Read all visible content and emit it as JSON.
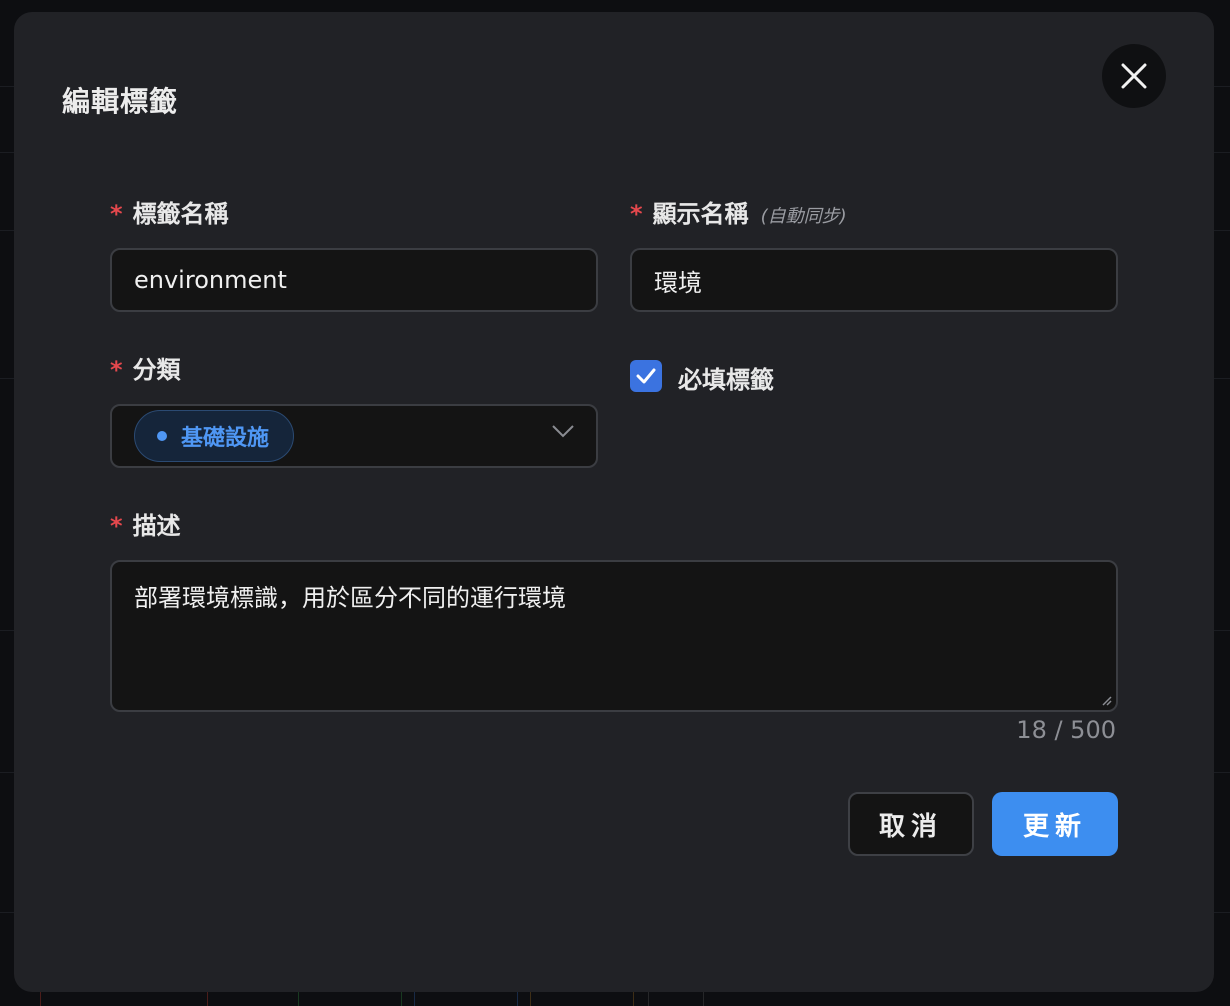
{
  "modal": {
    "title": "編輯標籤",
    "close_icon": "close-icon"
  },
  "form": {
    "tag_name": {
      "required_mark": "*",
      "label": "標籤名稱",
      "value": "environment"
    },
    "display_name": {
      "required_mark": "*",
      "label": "顯示名稱",
      "hint": "(自動同步)",
      "value": "環境"
    },
    "category": {
      "required_mark": "*",
      "label": "分類",
      "selected": "基礎設施",
      "selected_color": "#4f97f4",
      "icon": "chevron-down-icon"
    },
    "required_tag": {
      "label": "必填標籤",
      "checked": true
    },
    "description": {
      "required_mark": "*",
      "label": "描述",
      "value": "部署環境標識，用於區分不同的運行環境",
      "counter": "18 / 500"
    }
  },
  "actions": {
    "cancel_label": "取消",
    "update_label": "更新"
  },
  "colors": {
    "accent": "#3d8ef0",
    "required": "#e5484d",
    "checkbox": "#3b73e0"
  }
}
